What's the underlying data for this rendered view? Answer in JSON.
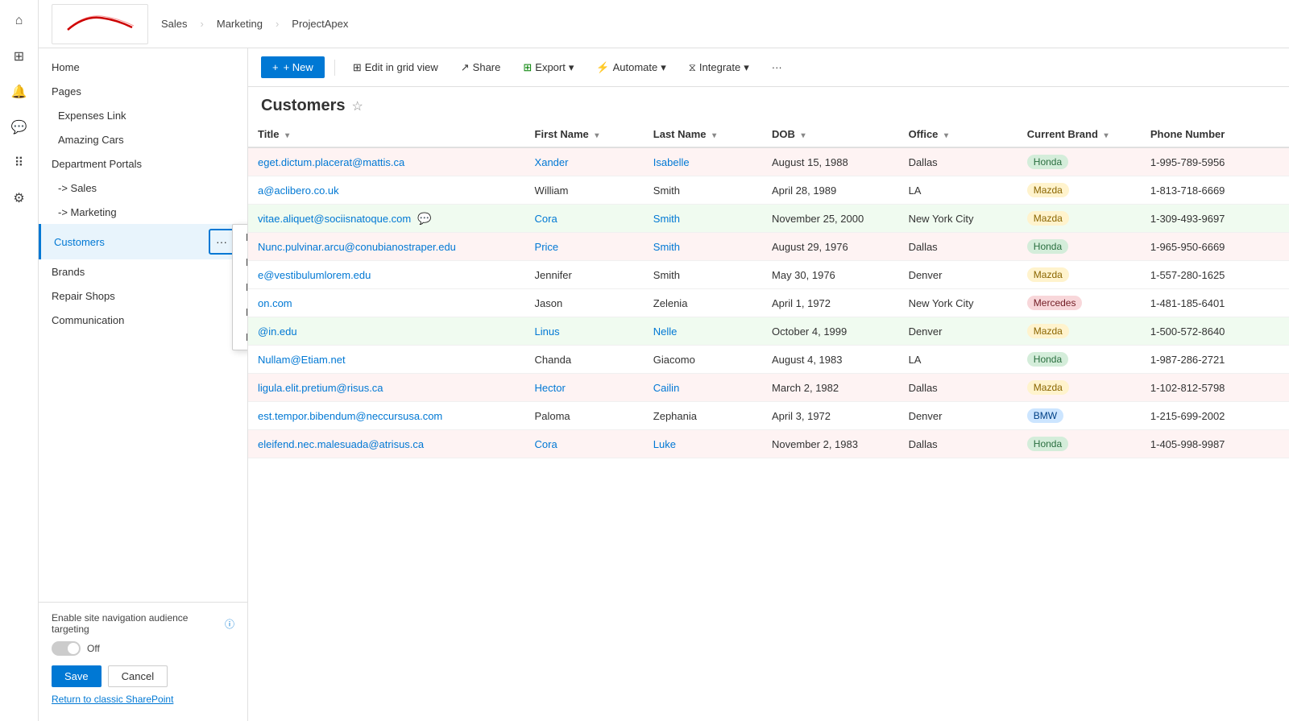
{
  "iconRail": {
    "items": [
      {
        "name": "home-icon",
        "icon": "⌂",
        "active": false
      },
      {
        "name": "grid-icon",
        "icon": "⊞",
        "active": false
      },
      {
        "name": "bell-icon",
        "icon": "🔔",
        "active": false
      },
      {
        "name": "chat-icon",
        "icon": "💬",
        "active": false
      },
      {
        "name": "apps-icon",
        "icon": "⋮⋮",
        "active": false
      },
      {
        "name": "settings-icon",
        "icon": "⚙",
        "active": false
      }
    ]
  },
  "header": {
    "breadcrumbs": [
      "Sales",
      "Marketing",
      "ProjectApex"
    ]
  },
  "sidebar": {
    "items": [
      {
        "label": "Home",
        "dots": "···",
        "active": false,
        "sub": false
      },
      {
        "label": "Pages",
        "dots": "···",
        "active": false,
        "sub": false
      },
      {
        "label": "Expenses Link",
        "dots": "···",
        "active": false,
        "sub": true
      },
      {
        "label": "Amazing Cars",
        "dots": "···",
        "active": false,
        "sub": true
      },
      {
        "label": "Department Portals",
        "dots": "···",
        "active": false,
        "sub": false
      },
      {
        "label": "-> Sales",
        "dots": "···",
        "active": false,
        "sub": true
      },
      {
        "label": "-> Marketing",
        "dots": "···",
        "active": false,
        "sub": true
      },
      {
        "label": "Customers",
        "dots": "···",
        "active": true,
        "sub": false
      },
      {
        "label": "Brands",
        "dots": "···",
        "active": false,
        "sub": false
      },
      {
        "label": "Repair Shops",
        "dots": "···",
        "active": false,
        "sub": false
      },
      {
        "label": "Communication",
        "dots": "···",
        "active": false,
        "sub": false
      }
    ],
    "enableTargeting": {
      "label": "Enable site navigation audience targeting",
      "infoIcon": "ⓘ",
      "toggle": "Off"
    },
    "save": "Save",
    "cancel": "Cancel",
    "returnLink": "Return to classic SharePoint"
  },
  "contextMenu": {
    "items": [
      "Edit",
      "Move up",
      "Make sub link",
      "Promote sub link",
      "Remove"
    ]
  },
  "toolbar": {
    "new": "+ New",
    "editInGrid": "Edit in grid view",
    "share": "Share",
    "export": "Export",
    "automate": "Automate",
    "integrate": "Integrate",
    "more": "···"
  },
  "pageTitle": "Customers",
  "table": {
    "columns": [
      "Title",
      "First Name",
      "Last Name",
      "DOB",
      "Office",
      "Current Brand",
      "Phone Number"
    ],
    "rows": [
      {
        "title": "eget.dictum.placerat@mattis.ca",
        "firstName": "Xander",
        "lastName": "Isabelle",
        "dob": "August 15, 1988",
        "office": "Dallas",
        "brand": "Honda",
        "phone": "1-995-789-5956",
        "highlight": "red",
        "firstNameHighlight": true,
        "lastNameHighlight": true
      },
      {
        "title": "a@aclibero.co.uk",
        "firstName": "William",
        "lastName": "Smith",
        "dob": "April 28, 1989",
        "office": "LA",
        "brand": "Mazda",
        "phone": "1-813-718-6669",
        "highlight": "none"
      },
      {
        "title": "vitae.aliquet@sociisnatoque.com",
        "firstName": "Cora",
        "lastName": "Smith",
        "dob": "November 25, 2000",
        "office": "New York City",
        "brand": "Mazda",
        "phone": "1-309-493-9697",
        "highlight": "green",
        "firstNameHighlight": true,
        "lastNameHighlight": true,
        "chatIcon": true
      },
      {
        "title": "Nunc.pulvinar.arcu@conubianostraper.edu",
        "firstName": "Price",
        "lastName": "Smith",
        "dob": "August 29, 1976",
        "office": "Dallas",
        "brand": "Honda",
        "phone": "1-965-950-6669",
        "highlight": "red",
        "firstNameHighlight": true,
        "lastNameHighlight": true
      },
      {
        "title": "e@vestibulumlorem.edu",
        "firstName": "Jennifer",
        "lastName": "Smith",
        "dob": "May 30, 1976",
        "office": "Denver",
        "brand": "Mazda",
        "phone": "1-557-280-1625",
        "highlight": "none"
      },
      {
        "title": "on.com",
        "firstName": "Jason",
        "lastName": "Zelenia",
        "dob": "April 1, 1972",
        "office": "New York City",
        "brand": "Mercedes",
        "phone": "1-481-185-6401",
        "highlight": "none"
      },
      {
        "title": "@in.edu",
        "firstName": "Linus",
        "lastName": "Nelle",
        "dob": "October 4, 1999",
        "office": "Denver",
        "brand": "Mazda",
        "phone": "1-500-572-8640",
        "highlight": "green",
        "firstNameHighlight": true,
        "lastNameHighlight": true
      },
      {
        "title": "Nullam@Etiam.net",
        "firstName": "Chanda",
        "lastName": "Giacomo",
        "dob": "August 4, 1983",
        "office": "LA",
        "brand": "Honda",
        "phone": "1-987-286-2721",
        "highlight": "none"
      },
      {
        "title": "ligula.elit.pretium@risus.ca",
        "firstName": "Hector",
        "lastName": "Cailin",
        "dob": "March 2, 1982",
        "office": "Dallas",
        "brand": "Mazda",
        "phone": "1-102-812-5798",
        "highlight": "red",
        "firstNameHighlight": true,
        "lastNameHighlight": true
      },
      {
        "title": "est.tempor.bibendum@neccursusa.com",
        "firstName": "Paloma",
        "lastName": "Zephania",
        "dob": "April 3, 1972",
        "office": "Denver",
        "brand": "BMW",
        "phone": "1-215-699-2002",
        "highlight": "none"
      },
      {
        "title": "eleifend.nec.malesuada@atrisus.ca",
        "firstName": "Cora",
        "lastName": "Luke",
        "dob": "November 2, 1983",
        "office": "Dallas",
        "brand": "Honda",
        "phone": "1-405-998-9987",
        "highlight": "red",
        "firstNameHighlight": true,
        "lastNameHighlight": true
      }
    ]
  }
}
